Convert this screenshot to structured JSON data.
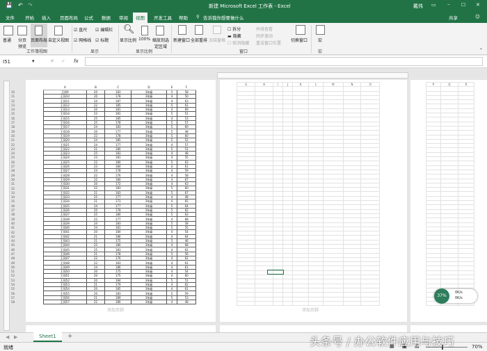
{
  "title": "新建 Microsoft Excel 工作表 - Excel",
  "user": "戴伟",
  "qat": {
    "save": "💾",
    "undo": "↶",
    "redo": "↷"
  },
  "tabs": [
    "文件",
    "开始",
    "插入",
    "页面布局",
    "公式",
    "数据",
    "审阅",
    "视图",
    "开发工具",
    "帮助"
  ],
  "tell_me": "告诉我你想要做什么",
  "share": "共享",
  "ribbon": {
    "views": [
      "普通",
      "分页预览",
      "页面布局",
      "自定义视图"
    ],
    "show": {
      "ruler": "直尺",
      "formula_bar": "编辑栏",
      "gridlines": "网格线",
      "headings": "标题"
    },
    "zoom": [
      "显示比例",
      "100%",
      "缩放到选定区域"
    ],
    "window": [
      "新建窗口",
      "全部重排",
      "冻结窗格",
      "拆分",
      "隐藏",
      "取消隐藏",
      "并排查看",
      "同步滚动",
      "重设窗口位置",
      "切换窗口"
    ],
    "macro": "宏",
    "groups": [
      "工作簿视图",
      "显示",
      "显示比例",
      "窗口",
      "宏"
    ]
  },
  "namebox": "I51",
  "fx": "fx",
  "page1": {
    "columns": [
      "A",
      "B",
      "C",
      "D",
      "E",
      "F"
    ],
    "grade": "3年级",
    "rows": [
      [
        "王同9",
        20,
        183,
        5,
        58
      ],
      [
        "王同10",
        20,
        178,
        4,
        50
      ],
      [
        "王同11",
        24,
        187,
        4,
        63
      ],
      [
        "王同12",
        22,
        185,
        5,
        61
      ],
      [
        "王同13",
        20,
        181,
        4,
        69
      ],
      [
        "王同14",
        23,
        181,
        5,
        51
      ],
      [
        "王同15",
        25,
        185,
        4,
        53
      ],
      [
        "王同16",
        25,
        178,
        5,
        57
      ],
      [
        "王同17",
        24,
        183,
        5,
        60
      ],
      [
        "王同18",
        20,
        177,
        5,
        48
      ],
      [
        "王同19",
        22,
        178,
        5,
        60
      ],
      [
        "王同20",
        24,
        185,
        5,
        52
      ],
      [
        "王同21",
        24,
        177,
        4,
        57
      ],
      [
        "王同22",
        21,
        180,
        5,
        51
      ],
      [
        "王同23",
        25,
        183,
        4,
        48
      ],
      [
        "王同24",
        23,
        181,
        4,
        55
      ],
      [
        "王同25",
        22,
        180,
        5,
        63
      ],
      [
        "王同26",
        23,
        184,
        4,
        61
      ],
      [
        "王同27",
        24,
        178,
        4,
        59
      ],
      [
        "王同28",
        22,
        176,
        4,
        58
      ],
      [
        "王同29",
        22,
        180,
        4,
        67
      ],
      [
        "王同30",
        20,
        172,
        4,
        63
      ],
      [
        "王同31",
        22,
        183,
        5,
        60
      ],
      [
        "王同32",
        21,
        183,
        5,
        67
      ],
      [
        "王同33",
        25,
        177,
        4,
        48
      ],
      [
        "王同34",
        21,
        173,
        4,
        65
      ],
      [
        "王同35",
        24,
        177,
        5,
        64
      ],
      [
        "王同36",
        20,
        178,
        5,
        62
      ],
      [
        "王同37",
        25,
        180,
        5,
        63
      ],
      [
        "王同38",
        22,
        177,
        4,
        68
      ],
      [
        "王同39",
        24,
        183,
        5,
        58
      ],
      [
        "王同40",
        24,
        181,
        5,
        55
      ],
      [
        "王同41",
        20,
        184,
        4,
        54
      ],
      [
        "王同42",
        21,
        186,
        4,
        64
      ],
      [
        "王同43",
        21,
        175,
        5,
        46
      ],
      [
        "王同44",
        25,
        180,
        4,
        68
      ],
      [
        "王同45",
        25,
        183,
        4,
        62
      ],
      [
        "王同46",
        21,
        178,
        5,
        56
      ],
      [
        "王同47",
        22,
        176,
        4,
        62
      ],
      [
        "王同48",
        22,
        183,
        4,
        61
      ],
      [
        "王同49",
        24,
        186,
        4,
        61
      ],
      [
        "王同50",
        20,
        175,
        4,
        54
      ],
      [
        "王同51",
        20,
        175,
        4,
        60
      ],
      [
        "王同52",
        20,
        184,
        5,
        51
      ],
      [
        "王同53",
        21,
        179,
        4,
        62
      ],
      [
        "王同54",
        20,
        185,
        4,
        61
      ],
      [
        "王同55",
        20,
        183,
        5,
        59
      ],
      [
        "王同56",
        21,
        189,
        5,
        53
      ],
      [
        "王同57",
        22,
        186,
        4,
        48
      ]
    ],
    "first_row_number": 10
  },
  "page2": {
    "columns": [
      "G",
      "H",
      "I",
      "J",
      "K",
      "L",
      "M",
      "N",
      "O"
    ]
  },
  "page3": {
    "columns": [
      "P",
      "Q",
      "R"
    ]
  },
  "footer": "添加页脚",
  "sheet": "Sheet1",
  "add_sheet": "+",
  "status": "就绪",
  "zoom": "70%",
  "net": {
    "percent": "37%",
    "up": "0K/s",
    "down": "0K/s"
  },
  "watermark": "头条号 / 办公软件应用与技巧",
  "colors": {
    "accent": "#217346"
  }
}
